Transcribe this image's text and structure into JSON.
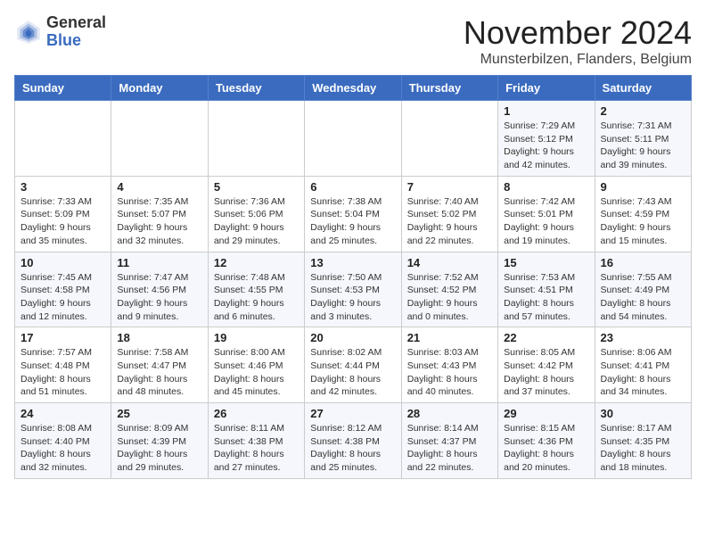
{
  "header": {
    "logo_general": "General",
    "logo_blue": "Blue",
    "month_title": "November 2024",
    "location": "Munsterbilzen, Flanders, Belgium"
  },
  "weekdays": [
    "Sunday",
    "Monday",
    "Tuesday",
    "Wednesday",
    "Thursday",
    "Friday",
    "Saturday"
  ],
  "weeks": [
    [
      {
        "day": "",
        "info": ""
      },
      {
        "day": "",
        "info": ""
      },
      {
        "day": "",
        "info": ""
      },
      {
        "day": "",
        "info": ""
      },
      {
        "day": "",
        "info": ""
      },
      {
        "day": "1",
        "info": "Sunrise: 7:29 AM\nSunset: 5:12 PM\nDaylight: 9 hours and 42 minutes."
      },
      {
        "day": "2",
        "info": "Sunrise: 7:31 AM\nSunset: 5:11 PM\nDaylight: 9 hours and 39 minutes."
      }
    ],
    [
      {
        "day": "3",
        "info": "Sunrise: 7:33 AM\nSunset: 5:09 PM\nDaylight: 9 hours and 35 minutes."
      },
      {
        "day": "4",
        "info": "Sunrise: 7:35 AM\nSunset: 5:07 PM\nDaylight: 9 hours and 32 minutes."
      },
      {
        "day": "5",
        "info": "Sunrise: 7:36 AM\nSunset: 5:06 PM\nDaylight: 9 hours and 29 minutes."
      },
      {
        "day": "6",
        "info": "Sunrise: 7:38 AM\nSunset: 5:04 PM\nDaylight: 9 hours and 25 minutes."
      },
      {
        "day": "7",
        "info": "Sunrise: 7:40 AM\nSunset: 5:02 PM\nDaylight: 9 hours and 22 minutes."
      },
      {
        "day": "8",
        "info": "Sunrise: 7:42 AM\nSunset: 5:01 PM\nDaylight: 9 hours and 19 minutes."
      },
      {
        "day": "9",
        "info": "Sunrise: 7:43 AM\nSunset: 4:59 PM\nDaylight: 9 hours and 15 minutes."
      }
    ],
    [
      {
        "day": "10",
        "info": "Sunrise: 7:45 AM\nSunset: 4:58 PM\nDaylight: 9 hours and 12 minutes."
      },
      {
        "day": "11",
        "info": "Sunrise: 7:47 AM\nSunset: 4:56 PM\nDaylight: 9 hours and 9 minutes."
      },
      {
        "day": "12",
        "info": "Sunrise: 7:48 AM\nSunset: 4:55 PM\nDaylight: 9 hours and 6 minutes."
      },
      {
        "day": "13",
        "info": "Sunrise: 7:50 AM\nSunset: 4:53 PM\nDaylight: 9 hours and 3 minutes."
      },
      {
        "day": "14",
        "info": "Sunrise: 7:52 AM\nSunset: 4:52 PM\nDaylight: 9 hours and 0 minutes."
      },
      {
        "day": "15",
        "info": "Sunrise: 7:53 AM\nSunset: 4:51 PM\nDaylight: 8 hours and 57 minutes."
      },
      {
        "day": "16",
        "info": "Sunrise: 7:55 AM\nSunset: 4:49 PM\nDaylight: 8 hours and 54 minutes."
      }
    ],
    [
      {
        "day": "17",
        "info": "Sunrise: 7:57 AM\nSunset: 4:48 PM\nDaylight: 8 hours and 51 minutes."
      },
      {
        "day": "18",
        "info": "Sunrise: 7:58 AM\nSunset: 4:47 PM\nDaylight: 8 hours and 48 minutes."
      },
      {
        "day": "19",
        "info": "Sunrise: 8:00 AM\nSunset: 4:46 PM\nDaylight: 8 hours and 45 minutes."
      },
      {
        "day": "20",
        "info": "Sunrise: 8:02 AM\nSunset: 4:44 PM\nDaylight: 8 hours and 42 minutes."
      },
      {
        "day": "21",
        "info": "Sunrise: 8:03 AM\nSunset: 4:43 PM\nDaylight: 8 hours and 40 minutes."
      },
      {
        "day": "22",
        "info": "Sunrise: 8:05 AM\nSunset: 4:42 PM\nDaylight: 8 hours and 37 minutes."
      },
      {
        "day": "23",
        "info": "Sunrise: 8:06 AM\nSunset: 4:41 PM\nDaylight: 8 hours and 34 minutes."
      }
    ],
    [
      {
        "day": "24",
        "info": "Sunrise: 8:08 AM\nSunset: 4:40 PM\nDaylight: 8 hours and 32 minutes."
      },
      {
        "day": "25",
        "info": "Sunrise: 8:09 AM\nSunset: 4:39 PM\nDaylight: 8 hours and 29 minutes."
      },
      {
        "day": "26",
        "info": "Sunrise: 8:11 AM\nSunset: 4:38 PM\nDaylight: 8 hours and 27 minutes."
      },
      {
        "day": "27",
        "info": "Sunrise: 8:12 AM\nSunset: 4:38 PM\nDaylight: 8 hours and 25 minutes."
      },
      {
        "day": "28",
        "info": "Sunrise: 8:14 AM\nSunset: 4:37 PM\nDaylight: 8 hours and 22 minutes."
      },
      {
        "day": "29",
        "info": "Sunrise: 8:15 AM\nSunset: 4:36 PM\nDaylight: 8 hours and 20 minutes."
      },
      {
        "day": "30",
        "info": "Sunrise: 8:17 AM\nSunset: 4:35 PM\nDaylight: 8 hours and 18 minutes."
      }
    ]
  ]
}
